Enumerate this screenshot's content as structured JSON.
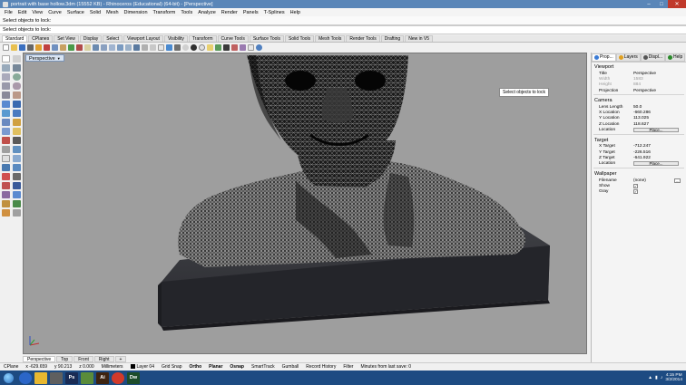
{
  "titlebar": {
    "title": "portrait with base hollow.3dm (15552 KB) - Rhinoceros (Educational) (64-bit) - [Perspective]",
    "controls": [
      "–",
      "□",
      "✕"
    ]
  },
  "menu": [
    "File",
    "Edit",
    "View",
    "Curve",
    "Surface",
    "Solid",
    "Mesh",
    "Dimension",
    "Transform",
    "Tools",
    "Analyze",
    "Render",
    "Panels",
    "T-Splines",
    "Help"
  ],
  "command": {
    "history": "Select objects to lock:",
    "prompt": "Select objects to lock:"
  },
  "toolbar_tabs": [
    "Standard",
    "CPlanes",
    "Set View",
    "Display",
    "Select",
    "Viewport Layout",
    "Visibility",
    "Transform",
    "Curve Tools",
    "Surface Tools",
    "Solid Tools",
    "Mesh Tools",
    "Render Tools",
    "Drafting",
    "New in V5"
  ],
  "viewport": {
    "label": "Perspective",
    "tooltip": "Select objects to lock"
  },
  "viewport_tabs": [
    "Perspective",
    "Top",
    "Front",
    "Right",
    "+"
  ],
  "panel": {
    "tabs": [
      {
        "label": "Prop...",
        "icon": "properties-icon",
        "color": "#3a7bd5"
      },
      {
        "label": "Layers",
        "icon": "layers-icon",
        "color": "#e0a020"
      },
      {
        "label": "Displ...",
        "icon": "display-icon",
        "color": "#555555"
      },
      {
        "label": "Help",
        "icon": "help-icon",
        "color": "#2a8a2a"
      }
    ],
    "viewport_section": "Viewport",
    "title_label": "Title",
    "title_value": "Perspective",
    "width_label": "Width",
    "width_value": "1583",
    "height_label": "Height",
    "height_value": "884",
    "projection_label": "Projection",
    "projection_value": "Perspective",
    "camera_section": "Camera",
    "lens_label": "Lens Length",
    "lens_value": "50.0",
    "xloc_label": "X Location",
    "xloc_value": "-660.286",
    "yloc_label": "Y Location",
    "yloc_value": "113.025",
    "zloc_label": "Z Location",
    "zloc_value": "118.627",
    "loc_label": "Location",
    "place_button": "Place...",
    "target_section": "Target",
    "xt_label": "X Target",
    "xt_value": "-712.247",
    "yt_label": "Y Target",
    "yt_value": "-226.516",
    "zt_label": "Z Target",
    "zt_value": "-641.922",
    "tloc_label": "Location",
    "tplace_button": "Place...",
    "wallpaper_section": "Wallpaper",
    "filename_label": "Filename",
    "filename_value": "(none)",
    "browse_button": "...",
    "show_label": "Show",
    "gray_label": "Gray",
    "check_mark": "✓"
  },
  "status": {
    "cplane": "CPlane",
    "x": "x -629.659",
    "y": "y 90.213",
    "z": "z 0.000",
    "units": "Millimeters",
    "layer": "Layer 04",
    "toggles": [
      "Grid Snap",
      "Ortho",
      "Planar",
      "Osnap",
      "SmartTrack",
      "Gumball",
      "Record History",
      "Filter"
    ],
    "save_info": "Minutes from last save: 0"
  },
  "taskbar": {
    "apps": [
      {
        "label": "",
        "color": "#2b66c8",
        "icon": "ie-icon"
      },
      {
        "label": "",
        "color": "#e8b830",
        "icon": "folder-icon"
      },
      {
        "label": "",
        "color": "#5f5f5f",
        "icon": "rhino-icon"
      },
      {
        "label": "Ps",
        "color": "#1a2c55",
        "icon": "photoshop-icon"
      },
      {
        "label": "",
        "color": "#5a8c3a",
        "icon": "app-icon"
      },
      {
        "label": "Ai",
        "color": "#3e2410",
        "icon": "illustrator-icon"
      },
      {
        "label": "",
        "color": "#d23a2a",
        "icon": "chrome-icon"
      },
      {
        "label": "Dw",
        "color": "#1d4d2a",
        "icon": "dreamweaver-icon"
      }
    ],
    "time": "4:15 PM",
    "date": "3/2/2014"
  }
}
